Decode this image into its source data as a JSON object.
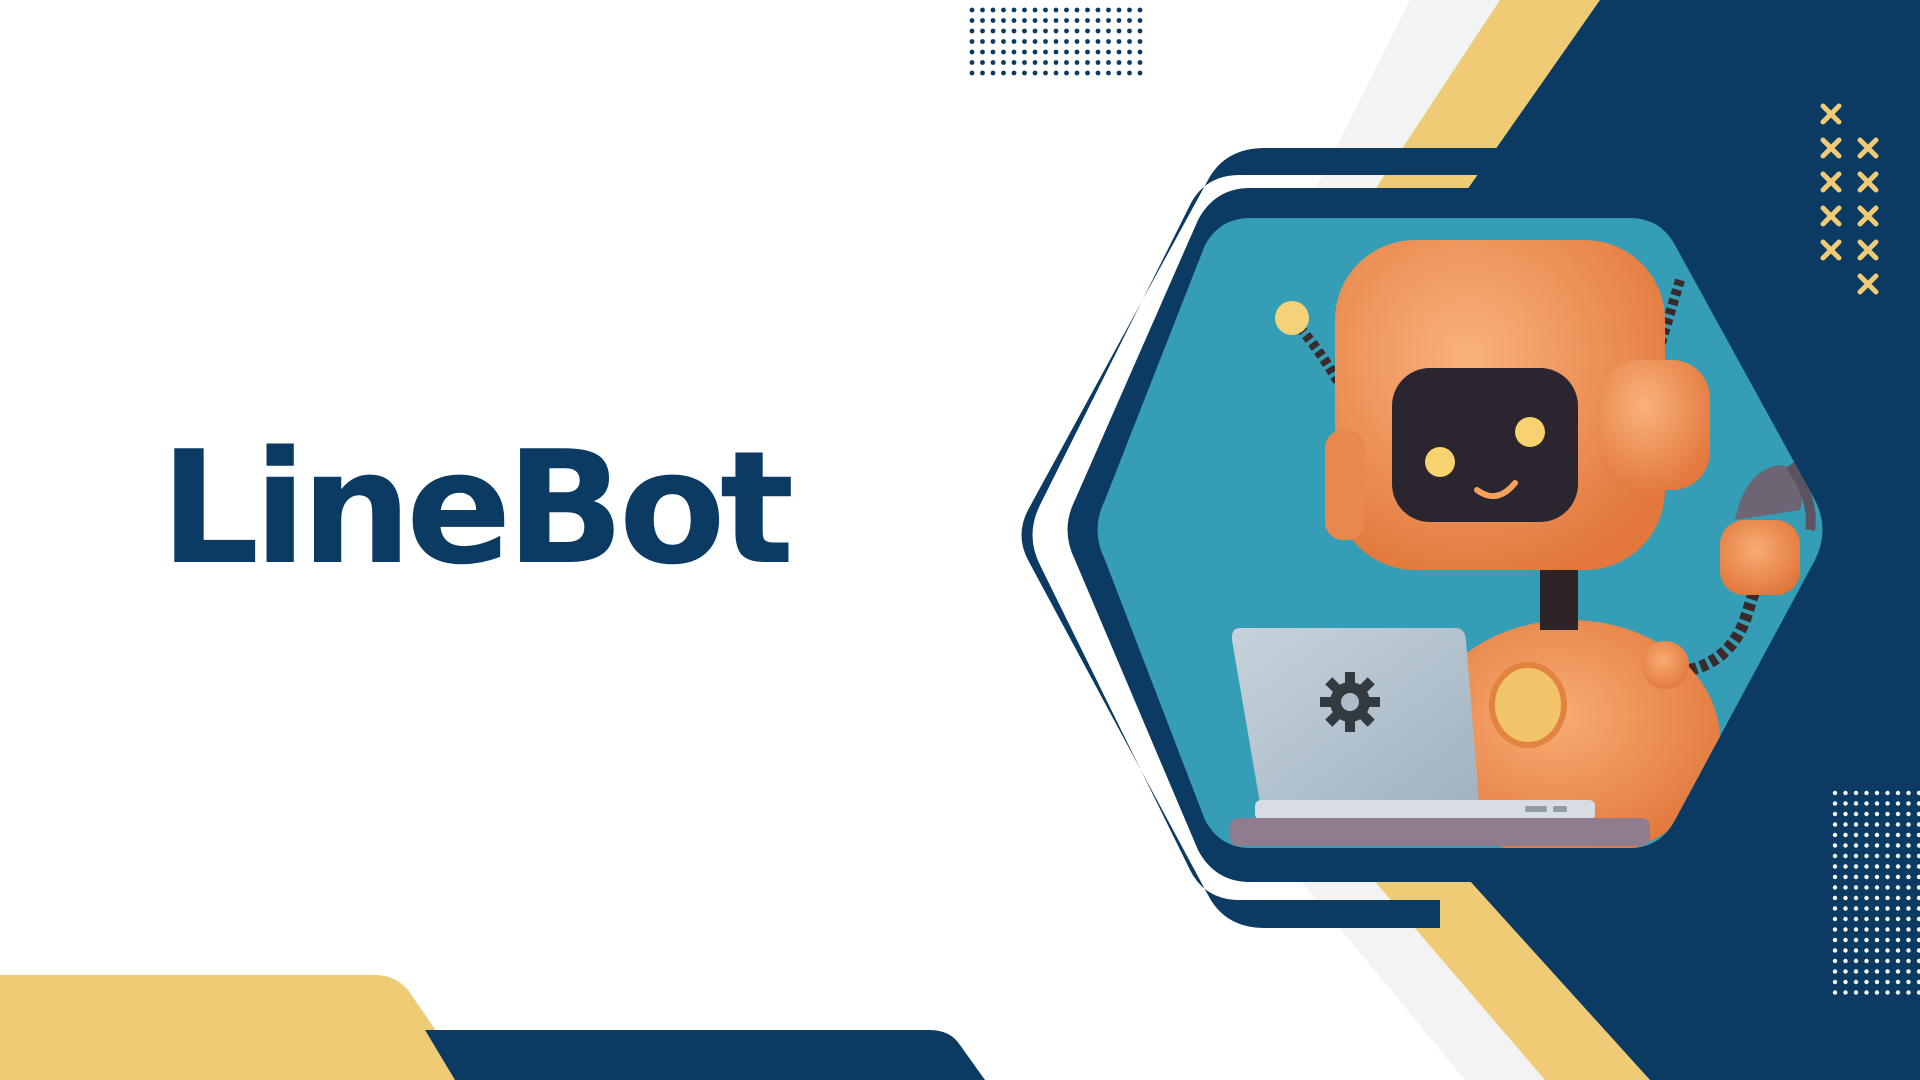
{
  "brand": {
    "title": "LineBot"
  },
  "colors": {
    "navy": "#0b3a62",
    "gold": "#f0cb76",
    "teal": "#359db5",
    "light_gray": "#f3f3f3",
    "robot_orange": "#f29a5c"
  },
  "illustration": {
    "subject": "robot-mascot",
    "laptop_icon": "gear-icon"
  }
}
